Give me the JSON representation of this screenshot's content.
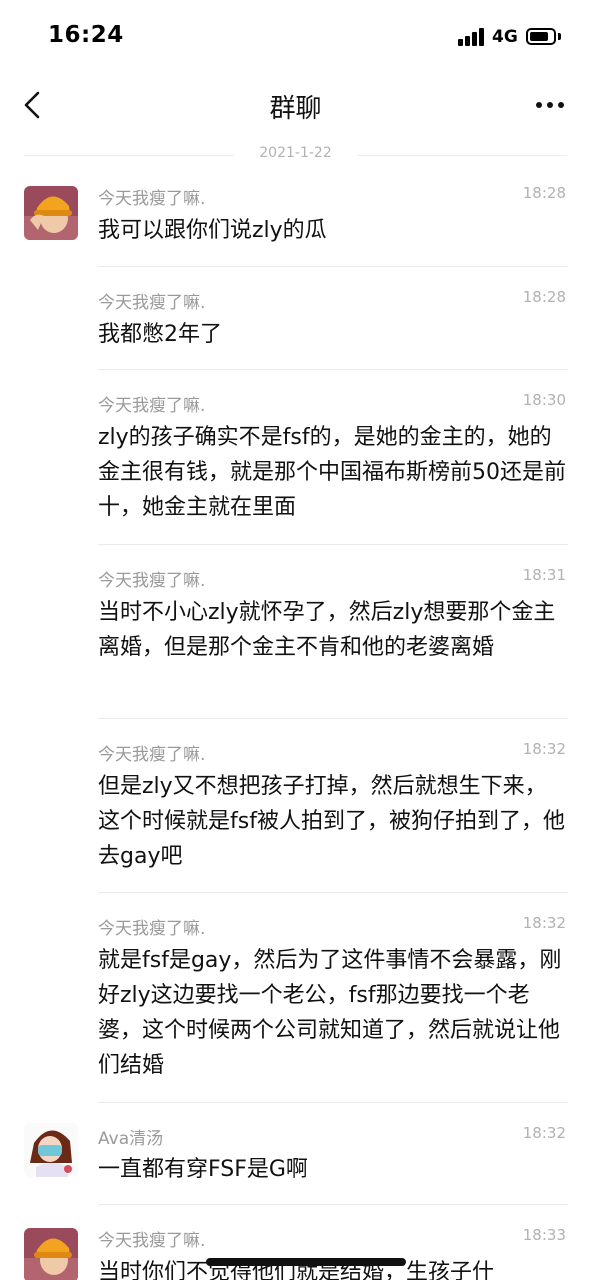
{
  "status_bar": {
    "time": "16:24",
    "network": "4G",
    "battery_level": 0.7
  },
  "nav": {
    "title": "群聊",
    "back_icon": "chevron-left-icon",
    "more_icon": "more-icon"
  },
  "date_separator": "2021-1-22",
  "messages": [
    {
      "sender": "今天我瘦了嘛.",
      "time": "18:28",
      "text": "我可以跟你们说zly的瓜",
      "avatar": "yellow-hat-avatar"
    },
    {
      "sender": "今天我瘦了嘛.",
      "time": "18:28",
      "text": "我都憋2年了"
    },
    {
      "sender": "今天我瘦了嘛.",
      "time": "18:30",
      "text": "zly的孩子确实不是fsf的，是她的金主的，她的金主很有钱，就是那个中国福布斯榜前50还是前十，她金主就在里面"
    },
    {
      "sender": "今天我瘦了嘛.",
      "time": "18:31",
      "text": "当时不小心zly就怀孕了，然后zly想要那个金主离婚，但是那个金主不肯和他的老婆离婚"
    },
    {
      "sender": "今天我瘦了嘛.",
      "time": "18:32",
      "text": "但是zly又不想把孩子打掉，然后就想生下来，这个时候就是fsf被人拍到了，被狗仔拍到了，他去gay吧"
    },
    {
      "sender": "今天我瘦了嘛.",
      "time": "18:32",
      "text": "就是fsf是gay，然后为了这件事情不会暴露，刚好zly这边要找一个老公，fsf那边要找一个老婆，这个时候两个公司就知道了，然后就说让他们结婚"
    },
    {
      "sender": "Ava清汤",
      "time": "18:32",
      "text": "一直都有穿FSF是G啊",
      "avatar": "cartoon-girl-avatar"
    },
    {
      "sender": "今天我瘦了嘛.",
      "time": "18:33",
      "text": "当时你们不觉得他们就是结婚，生孩子什",
      "avatar": "yellow-hat-avatar"
    }
  ]
}
